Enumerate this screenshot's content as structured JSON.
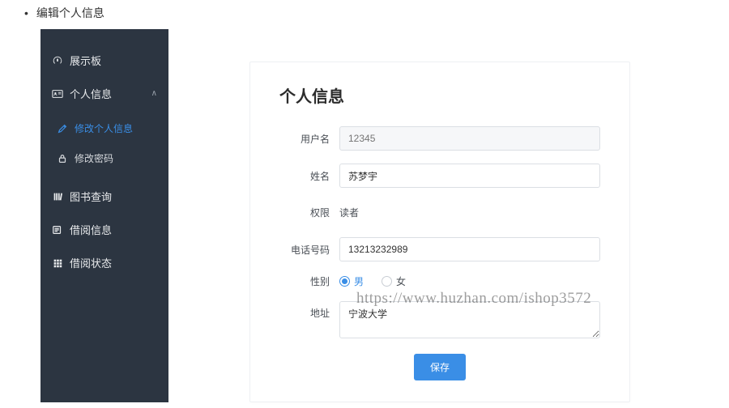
{
  "page_heading": "编辑个人信息",
  "sidebar": {
    "items": [
      {
        "label": "展示板",
        "icon": "dashboard"
      },
      {
        "label": "个人信息",
        "icon": "id-card",
        "expanded": true,
        "children": [
          {
            "label": "修改个人信息",
            "icon": "edit",
            "active": true
          },
          {
            "label": "修改密码",
            "icon": "lock"
          }
        ]
      },
      {
        "label": "图书查询",
        "icon": "bars"
      },
      {
        "label": "借阅信息",
        "icon": "list"
      },
      {
        "label": "借阅状态",
        "icon": "grid"
      }
    ]
  },
  "card": {
    "title": "个人信息",
    "fields": {
      "username_label": "用户名",
      "username_placeholder": "12345",
      "name_label": "姓名",
      "name_value": "苏梦宇",
      "role_label": "权限",
      "role_value": "读者",
      "phone_label": "电话号码",
      "phone_value": "13213232989",
      "gender_label": "性别",
      "gender_male": "男",
      "gender_female": "女",
      "gender_selected": "male",
      "address_label": "地址",
      "address_value": "宁波大学"
    },
    "save_label": "保存"
  },
  "watermark": "https://www.huzhan.com/ishop3572"
}
